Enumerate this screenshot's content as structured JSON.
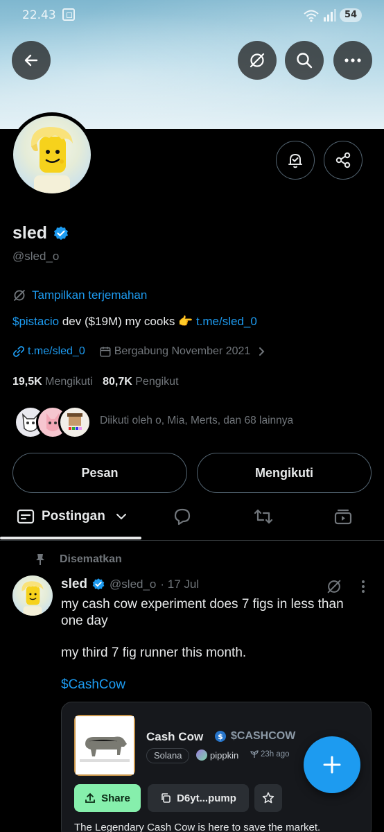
{
  "status_bar": {
    "time": "22.43",
    "battery": "54"
  },
  "profile": {
    "name": "sled",
    "handle": "@sled_o",
    "translate_label": "Tampilkan terjemahan",
    "bio": {
      "cashtag": "$pistacio",
      "text": " dev ($19M) my cooks 👉 ",
      "link": "t.me/sled_0"
    },
    "website": "t.me/sled_0",
    "joined": "Bergabung November 2021",
    "following_count": "19,5K",
    "following_label": "Mengikuti",
    "followers_count": "80,7K",
    "followers_label": "Pengikut",
    "followed_by": "Diikuti oleh o, Mia, Merts, dan 68 lainnya"
  },
  "actions": {
    "message": "Pesan",
    "following": "Mengikuti"
  },
  "tabs": {
    "posts_label": "Postingan"
  },
  "pinned_tweet": {
    "pinned_label": "Disematkan",
    "name": "sled",
    "handle": "@sled_o",
    "date": "· 17 Jul",
    "text_1": "my cash cow experiment does 7 figs in less than one day",
    "text_2": "my third 7 fig runner this month.",
    "cashtag": "$CashCow",
    "card": {
      "title": "Cash Cow",
      "ticker": "$CASHCOW",
      "chain": "Solana",
      "creator": "pippkin",
      "age": "23h ago",
      "share_label": "Share",
      "address": "D6yt...pump",
      "description": "The Legendary Cash Cow is here to save the market."
    }
  },
  "colors": {
    "accent": "#1d9bf0",
    "share_button": "#86efac"
  }
}
